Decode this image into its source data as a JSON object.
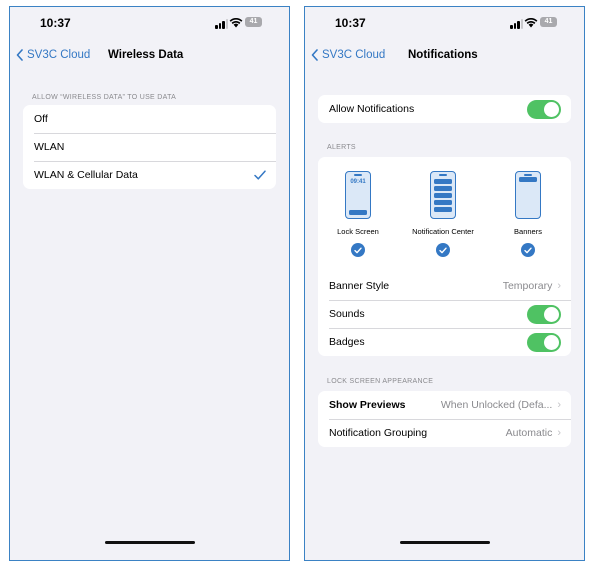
{
  "left": {
    "status": {
      "time": "10:37",
      "battery": "41"
    },
    "nav": {
      "back_label": "SV3C Cloud",
      "title": "Wireless Data"
    },
    "section_header": "ALLOW “WIRELESS DATA” TO USE DATA",
    "options": [
      {
        "label": "Off",
        "selected": false
      },
      {
        "label": "WLAN",
        "selected": false
      },
      {
        "label": "WLAN & Cellular Data",
        "selected": true
      }
    ]
  },
  "right": {
    "status": {
      "time": "10:37",
      "battery": "41"
    },
    "nav": {
      "back_label": "SV3C Cloud",
      "title": "Notifications"
    },
    "allow_notifications": {
      "label": "Allow Notifications",
      "on": true
    },
    "alerts_header": "ALERTS",
    "alert_styles": [
      {
        "label": "Lock Screen",
        "preview_time": "09:41",
        "checked": true
      },
      {
        "label": "Notification Center",
        "checked": true
      },
      {
        "label": "Banners",
        "checked": true
      }
    ],
    "banner_style": {
      "label": "Banner Style",
      "value": "Temporary"
    },
    "sounds": {
      "label": "Sounds",
      "on": true
    },
    "badges": {
      "label": "Badges",
      "on": true
    },
    "lock_header": "LOCK SCREEN APPEARANCE",
    "show_previews": {
      "label": "Show Previews",
      "value": "When Unlocked (Defa..."
    },
    "grouping": {
      "label": "Notification Grouping",
      "value": "Automatic"
    }
  },
  "colors": {
    "accent": "#3478c4",
    "toggle_on": "#4fc263",
    "frame": "#3b82c4",
    "background": "#f2f2f7"
  },
  "icons": [
    "chevron-left-icon",
    "checkmark-icon",
    "chevron-right-icon",
    "signal-icon",
    "wifi-icon",
    "battery-icon"
  ]
}
